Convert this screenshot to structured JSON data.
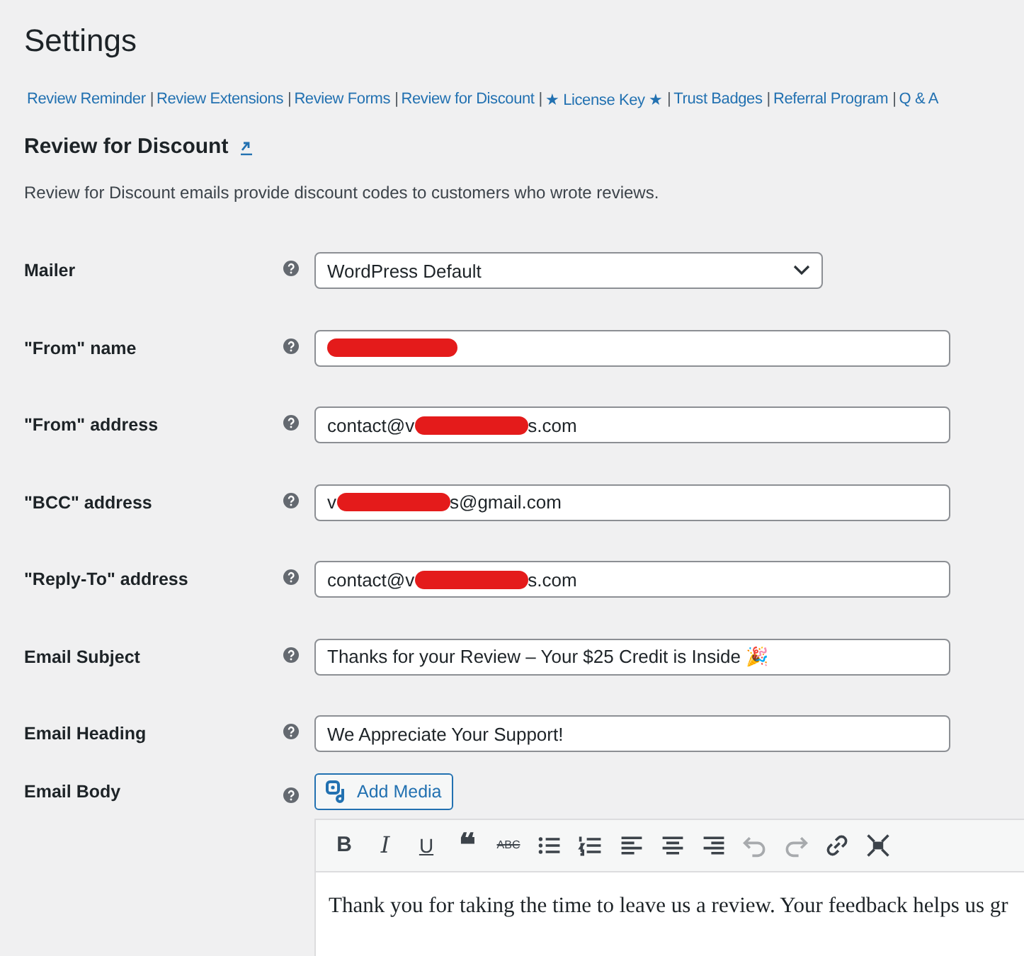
{
  "page_title": "Settings",
  "nav_separator": "|",
  "nav_links": [
    {
      "label": "Review Reminder"
    },
    {
      "label": "Review Extensions"
    },
    {
      "label": "Review Forms"
    },
    {
      "label": "Review for Discount"
    },
    {
      "label": "★ License Key ★"
    },
    {
      "label": "Trust Badges"
    },
    {
      "label": "Referral Program"
    },
    {
      "label": "Q & A"
    }
  ],
  "section": {
    "title": "Review for Discount",
    "description": "Review for Discount emails provide discount codes to customers who wrote reviews."
  },
  "fields": [
    {
      "label": "Mailer",
      "kind": "select",
      "value": "WordPress Default"
    },
    {
      "label": "\"From\" name",
      "kind": "text",
      "redacted": true
    },
    {
      "label": "\"From\" address",
      "kind": "text",
      "value_before": "contact@v",
      "redacted": true,
      "value_after": "s.com"
    },
    {
      "label": "\"BCC\" address",
      "kind": "text",
      "value_before": "v",
      "redacted": true,
      "value_after": "s@gmail.com"
    },
    {
      "label": "\"Reply-To\" address",
      "kind": "text",
      "value_before": "contact@v",
      "redacted": true,
      "value_after": "s.com"
    },
    {
      "label": "Email Subject",
      "kind": "text",
      "value": "Thanks for your Review – Your $25 Credit is Inside 🎉"
    },
    {
      "label": "Email Heading",
      "kind": "text",
      "value": "We Appreciate Your Support!"
    },
    {
      "label": "Email Body",
      "kind": "editor"
    }
  ],
  "editor": {
    "add_media": "Add Media",
    "toolbar": [
      {
        "kind": "bold",
        "text": "B",
        "disabled": false
      },
      {
        "kind": "italic",
        "text": "I",
        "disabled": false
      },
      {
        "kind": "underline",
        "text": "U",
        "disabled": false
      },
      {
        "kind": "quote",
        "text": "❝",
        "disabled": false
      },
      {
        "kind": "strike",
        "text": "ABC",
        "disabled": false
      },
      {
        "kind": "bullets",
        "disabled": false
      },
      {
        "kind": "numbers",
        "disabled": false
      },
      {
        "kind": "align-left",
        "disabled": false
      },
      {
        "kind": "align-center",
        "disabled": false
      },
      {
        "kind": "align-right",
        "disabled": false
      },
      {
        "kind": "undo",
        "disabled": true
      },
      {
        "kind": "redo",
        "disabled": true
      },
      {
        "kind": "link",
        "disabled": false
      },
      {
        "kind": "fullscreen",
        "disabled": false
      }
    ],
    "body": "Thank you for taking the time to leave us a review. Your feedback helps us gr"
  }
}
